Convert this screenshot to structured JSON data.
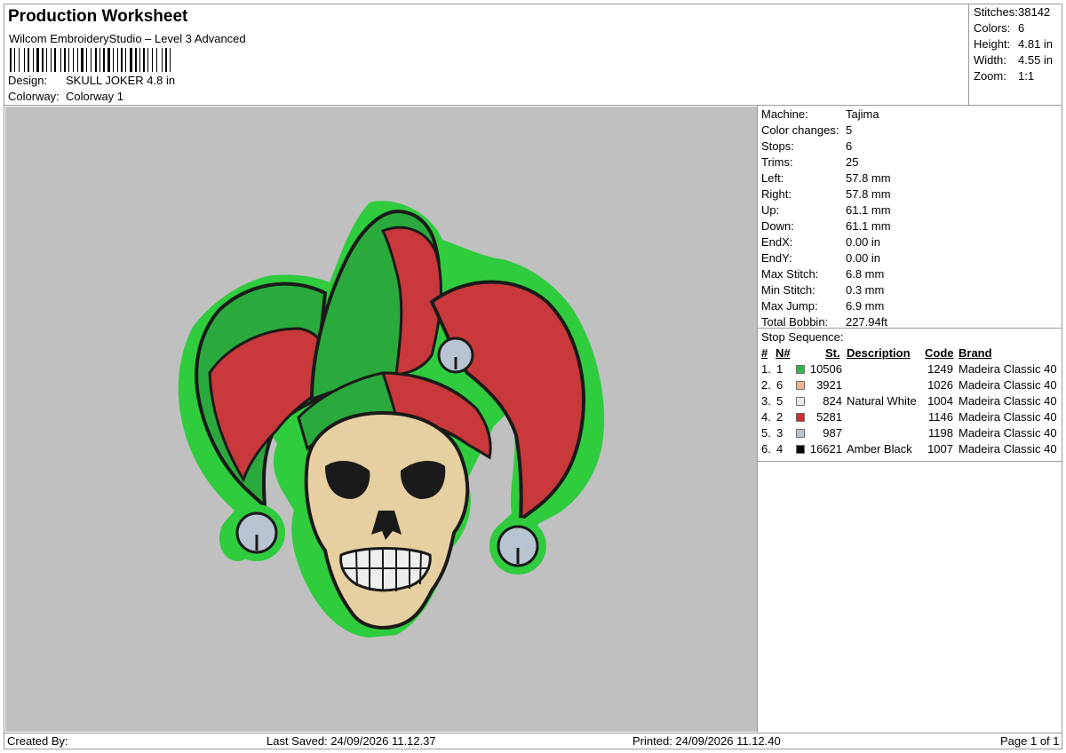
{
  "header": {
    "title": "Production Worksheet",
    "software": "Wilcom EmbroideryStudio – Level 3 Advanced",
    "design_label": "Design:",
    "design_value": "SKULL JOKER 4.8 in",
    "colorway_label": "Colorway:",
    "colorway_value": "Colorway 1"
  },
  "stats": [
    {
      "label": "Stitches:",
      "value": "38142"
    },
    {
      "label": "Colors:",
      "value": "6"
    },
    {
      "label": "Height:",
      "value": "4.81 in"
    },
    {
      "label": "Width:",
      "value": "4.55 in"
    },
    {
      "label": "Zoom:",
      "value": "1:1"
    }
  ],
  "machine_info": [
    {
      "label": "Machine:",
      "value": "Tajima"
    },
    {
      "label": "Color changes:",
      "value": "5"
    },
    {
      "label": "Stops:",
      "value": "6"
    },
    {
      "label": "Trims:",
      "value": "25"
    },
    {
      "label": "Left:",
      "value": "57.8 mm"
    },
    {
      "label": "Right:",
      "value": "57.8 mm"
    },
    {
      "label": "Up:",
      "value": "61.1 mm"
    },
    {
      "label": "Down:",
      "value": "61.1 mm"
    },
    {
      "label": "EndX:",
      "value": "0.00 in"
    },
    {
      "label": "EndY:",
      "value": "0.00 in"
    },
    {
      "label": "Max Stitch:",
      "value": "6.8 mm"
    },
    {
      "label": "Min Stitch:",
      "value": "0.3 mm"
    },
    {
      "label": "Max Jump:",
      "value": "6.9 mm"
    },
    {
      "label": "Total Bobbin:",
      "value": "227.94ft"
    }
  ],
  "stop_sequence": {
    "title": "Stop Sequence:",
    "headers": {
      "num": "#",
      "n": "N#",
      "st": "St.",
      "description": "Description",
      "code": "Code",
      "brand": "Brand"
    },
    "rows": [
      {
        "num": "1.",
        "n": "1",
        "color": "#2db84a",
        "st": "10506",
        "description": "",
        "code": "1249",
        "brand": "Madeira Classic 40"
      },
      {
        "num": "2.",
        "n": "6",
        "color": "#f0b48a",
        "st": "3921",
        "description": "",
        "code": "1026",
        "brand": "Madeira Classic 40"
      },
      {
        "num": "3.",
        "n": "5",
        "color": "#e8e8ec",
        "st": "824",
        "description": "Natural White",
        "code": "1004",
        "brand": "Madeira Classic 40"
      },
      {
        "num": "4.",
        "n": "2",
        "color": "#d42a2a",
        "st": "5281",
        "description": "",
        "code": "1146",
        "brand": "Madeira Classic 40"
      },
      {
        "num": "5.",
        "n": "3",
        "color": "#b8c4d2",
        "st": "987",
        "description": "",
        "code": "1198",
        "brand": "Madeira Classic 40"
      },
      {
        "num": "6.",
        "n": "4",
        "color": "#000000",
        "st": "16621",
        "description": "Amber Black",
        "code": "1007",
        "brand": "Madeira Classic 40"
      }
    ]
  },
  "footer": {
    "created_by": "Created By:",
    "last_saved": "Last Saved: 24/09/2026 11.12.37",
    "printed": "Printed: 24/09/2026 11.12.40",
    "page": "Page 1 of 1"
  },
  "colors": {
    "canvas_bg": "#c0c0c0",
    "hat_green": "#2db84a",
    "hat_red": "#c9383a",
    "skull": "#e6cfa0",
    "bell": "#b8c4d2",
    "outline": "#1a1a1a"
  }
}
